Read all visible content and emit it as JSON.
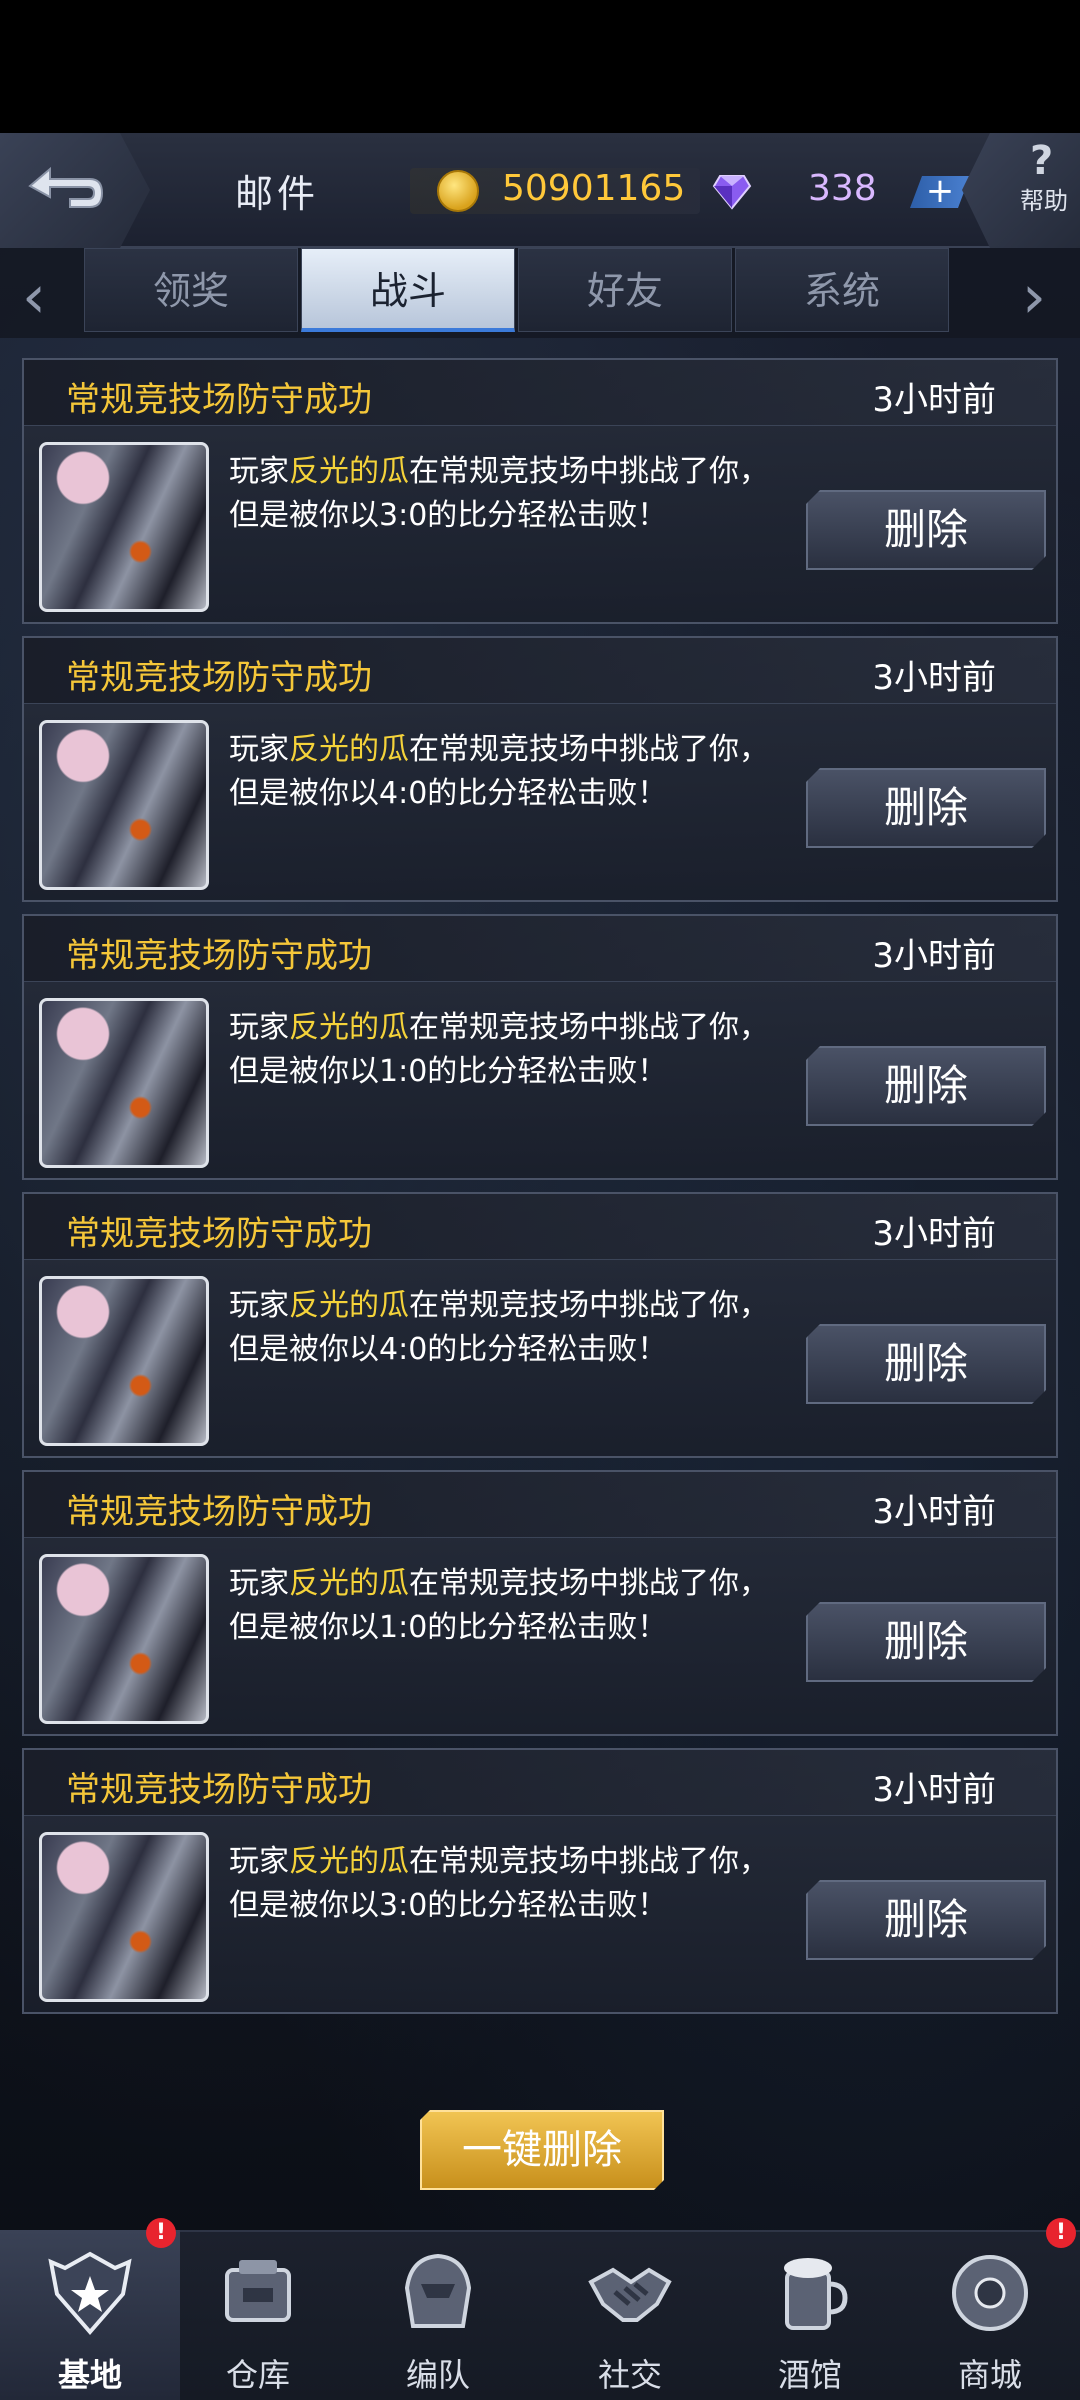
{
  "header": {
    "title": "邮件",
    "gold": "50901165",
    "diamonds": "338",
    "plus": "+",
    "help_symbol": "?",
    "help_label": "帮助"
  },
  "tabs": [
    {
      "label": "领奖",
      "active": false
    },
    {
      "label": "战斗",
      "active": true
    },
    {
      "label": "好友",
      "active": false
    },
    {
      "label": "系统",
      "active": false
    }
  ],
  "arrows": {
    "left": "‹",
    "right": "›"
  },
  "mails": [
    {
      "title": "常规竞技场防守成功",
      "time": "3小时前",
      "prefix": "玩家",
      "player": "反光的瓜",
      "suffix": "在常规竞技场中挑战了你，",
      "line2": "但是被你以3:0的比分轻松击败！",
      "delete": "删除"
    },
    {
      "title": "常规竞技场防守成功",
      "time": "3小时前",
      "prefix": "玩家",
      "player": "反光的瓜",
      "suffix": "在常规竞技场中挑战了你，",
      "line2": "但是被你以4:0的比分轻松击败！",
      "delete": "删除"
    },
    {
      "title": "常规竞技场防守成功",
      "time": "3小时前",
      "prefix": "玩家",
      "player": "反光的瓜",
      "suffix": "在常规竞技场中挑战了你，",
      "line2": "但是被你以1:0的比分轻松击败！",
      "delete": "删除"
    },
    {
      "title": "常规竞技场防守成功",
      "time": "3小时前",
      "prefix": "玩家",
      "player": "反光的瓜",
      "suffix": "在常规竞技场中挑战了你，",
      "line2": "但是被你以4:0的比分轻松击败！",
      "delete": "删除"
    },
    {
      "title": "常规竞技场防守成功",
      "time": "3小时前",
      "prefix": "玩家",
      "player": "反光的瓜",
      "suffix": "在常规竞技场中挑战了你，",
      "line2": "但是被你以1:0的比分轻松击败！",
      "delete": "删除"
    },
    {
      "title": "常规竞技场防守成功",
      "time": "3小时前",
      "prefix": "玩家",
      "player": "反光的瓜",
      "suffix": "在常规竞技场中挑战了你，",
      "line2": "但是被你以3:0的比分轻松击败！",
      "delete": "删除"
    }
  ],
  "delete_all": "一键删除",
  "nav": [
    {
      "label": "基地",
      "icon": "base-icon",
      "badge": "!",
      "active": true
    },
    {
      "label": "仓库",
      "icon": "warehouse-icon",
      "badge": "",
      "active": false
    },
    {
      "label": "编队",
      "icon": "formation-icon",
      "badge": "",
      "active": false
    },
    {
      "label": "社交",
      "icon": "handshake-icon",
      "badge": "",
      "active": false
    },
    {
      "label": "酒馆",
      "icon": "tavern-icon",
      "badge": "",
      "active": false
    },
    {
      "label": "商城",
      "icon": "shop-icon",
      "badge": "!",
      "active": false
    }
  ],
  "colors": {
    "accent_gold": "#f5c739",
    "player_name": "#f5d33a",
    "badge_red": "#e8242e"
  }
}
